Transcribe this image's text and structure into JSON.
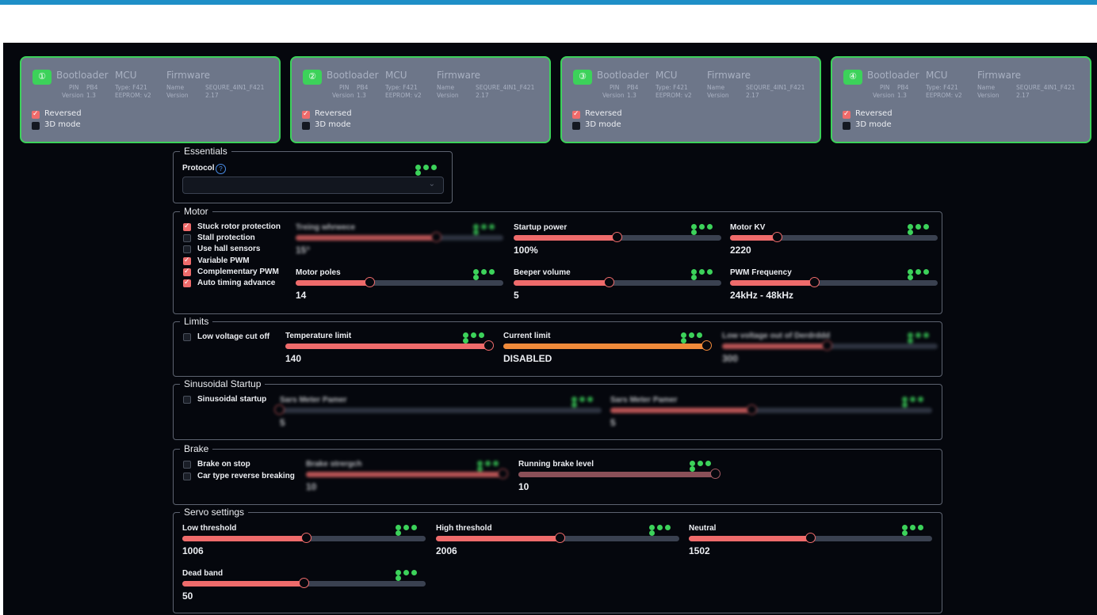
{
  "esc_cards": [
    {
      "number": "①",
      "bootloader": "Bootloader",
      "mcu": "MCU",
      "firmware": "Firmware",
      "pin_label": "PIN",
      "pin": "PB4",
      "version_label": "Version",
      "version": "1.3",
      "type": "Type: F421",
      "eeprom": "EEPROM: v2",
      "name_label": "Name",
      "name": "SEQURE_4IN1_F421",
      "fw_version_label": "Version",
      "fw_version": "2.17",
      "reversed": "Reversed",
      "mode3d": "3D mode"
    },
    {
      "number": "②",
      "bootloader": "Bootloader",
      "mcu": "MCU",
      "firmware": "Firmware",
      "pin_label": "PIN",
      "pin": "PB4",
      "version_label": "Version",
      "version": "1.3",
      "type": "Type: F421",
      "eeprom": "EEPROM: v2",
      "name_label": "Name",
      "name": "SEQURE_4IN1_F421",
      "fw_version_label": "Version",
      "fw_version": "2.17",
      "reversed": "Reversed",
      "mode3d": "3D mode"
    },
    {
      "number": "③",
      "bootloader": "Bootloader",
      "mcu": "MCU",
      "firmware": "Firmware",
      "pin_label": "PIN",
      "pin": "PB4",
      "version_label": "Version",
      "version": "1.3",
      "type": "Type: F421",
      "eeprom": "EEPROM: v2",
      "name_label": "Name",
      "name": "SEQURE_4IN1_F421",
      "fw_version_label": "Version",
      "fw_version": "2.17",
      "reversed": "Reversed",
      "mode3d": "3D mode"
    },
    {
      "number": "④",
      "bootloader": "Bootloader",
      "mcu": "MCU",
      "firmware": "Firmware",
      "pin_label": "PIN",
      "pin": "PB4",
      "version_label": "Version",
      "version": "1.3",
      "type": "Type: F421",
      "eeprom": "EEPROM: v2",
      "name_label": "Name",
      "name": "SEQURE_4IN1_F421",
      "fw_version_label": "Version",
      "fw_version": "2.17",
      "reversed": "Reversed",
      "mode3d": "3D mode"
    }
  ],
  "essentials": {
    "legend": "Essentials",
    "protocol_label": "Protocol",
    "protocol_value": ""
  },
  "motor": {
    "legend": "Motor",
    "checkboxes": [
      {
        "label": "Stuck rotor protection",
        "checked": true
      },
      {
        "label": "Stall protection",
        "checked": false
      },
      {
        "label": "Use hall sensors",
        "checked": false
      },
      {
        "label": "Variable PWM",
        "checked": true
      },
      {
        "label": "Complementary PWM",
        "checked": true
      },
      {
        "label": "Auto timing advance",
        "checked": true
      }
    ],
    "timing": {
      "label": "Treing whrwece",
      "value": "15°",
      "fraction": 0.68
    },
    "startup_power": {
      "label": "Startup power",
      "value": "100%",
      "fraction": 0.5
    },
    "motor_kv": {
      "label": "Motor KV",
      "value": "2220",
      "fraction": 0.23
    },
    "motor_poles": {
      "label": "Motor poles",
      "value": "14",
      "fraction": 0.36
    },
    "beeper_volume": {
      "label": "Beeper volume",
      "value": "5",
      "fraction": 0.46
    },
    "pwm_frequency": {
      "label": "PWM Frequency",
      "value": "24kHz - 48kHz",
      "fraction": 0.41
    }
  },
  "limits": {
    "legend": "Limits",
    "low_voltage_cutoff": "Low voltage cut off",
    "temperature_limit": {
      "label": "Temperature limit",
      "value": "140",
      "fraction": 0.98
    },
    "current_limit": {
      "label": "Current limit",
      "value": "DISABLED",
      "fraction": 0.98
    },
    "low_voltage_threshold": {
      "label": "Low voltage out of Derdrddd",
      "value": "300",
      "fraction": 0.49
    }
  },
  "sinusoidal": {
    "legend": "Sinusoidal Startup",
    "checkbox": "Sinusoidal startup",
    "slider1": {
      "label": "Sars Meter Pamer",
      "value": "5",
      "fraction": 0.0
    },
    "slider2": {
      "label": "Sars Meter Pamer",
      "value": "5",
      "fraction": 0.44
    }
  },
  "brake": {
    "legend": "Brake",
    "brake_on_stop": "Brake on stop",
    "car_type": "Car type reverse breaking",
    "brake_strength": {
      "label": "Brake strergch",
      "value": "10",
      "fraction": 0.98
    },
    "running_brake": {
      "label": "Running brake level",
      "value": "10",
      "fraction": 0.98
    }
  },
  "servo": {
    "legend": "Servo settings",
    "low_threshold": {
      "label": "Low threshold",
      "value": "1006",
      "fraction": 0.51
    },
    "high_threshold": {
      "label": "High threshold",
      "value": "2006",
      "fraction": 0.51
    },
    "neutral": {
      "label": "Neutral",
      "value": "1502",
      "fraction": 0.5
    },
    "dead_band": {
      "label": "Dead band",
      "value": "50",
      "fraction": 0.5
    }
  },
  "colors": {
    "accent": "#ef6b6b",
    "success": "#3cd25a",
    "warning": "#f08a3a",
    "card_bg": "#6d7689",
    "background": "#05070d",
    "topbar": "#1e8fc7"
  }
}
